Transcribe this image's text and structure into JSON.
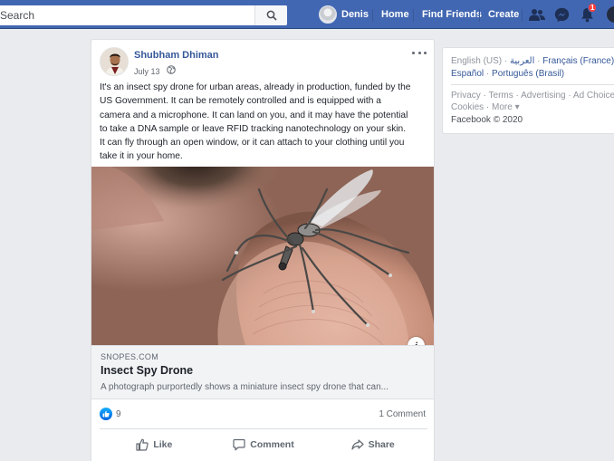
{
  "topbar": {
    "search_placeholder": "Search",
    "user_name": "Denis",
    "home_label": "Home",
    "find_friends_label": "Find Friends",
    "create_label": "Create",
    "notifications_count": "1",
    "color": "#4267b2"
  },
  "post": {
    "author": "Shubham Dhiman",
    "date": "July 13",
    "privacy_icon": "globe-icon",
    "text_lines": [
      "It's an insect spy drone for urban areas, already in production, funded by the",
      "US Government. It can be remotely controlled and is equipped with a",
      "camera and a microphone. It can land on you, and it may have the potential",
      "to take a DNA sample or leave RFID tracking nanotechnology on your skin.",
      "It can fly through an open window, or it can attach to your clothing until you",
      "take it in your home."
    ],
    "link": {
      "domain": "SNOPES.COM",
      "title": "Insect Spy Drone",
      "description": "A photograph purportedly shows a miniature insect spy drone that can..."
    },
    "reactions_count": "9",
    "comments_label": "1 Comment",
    "actions": {
      "like": "Like",
      "comment": "Comment",
      "share": "Share"
    }
  },
  "sidebar": {
    "current_language": "English (US)",
    "languages": [
      "العربية",
      "Français (France)",
      "Español",
      "Português (Brasil)"
    ],
    "footer_links": [
      "Privacy",
      "Terms",
      "Advertising",
      "Ad Choices",
      "Cookies",
      "More"
    ],
    "copyright": "Facebook © 2020"
  }
}
